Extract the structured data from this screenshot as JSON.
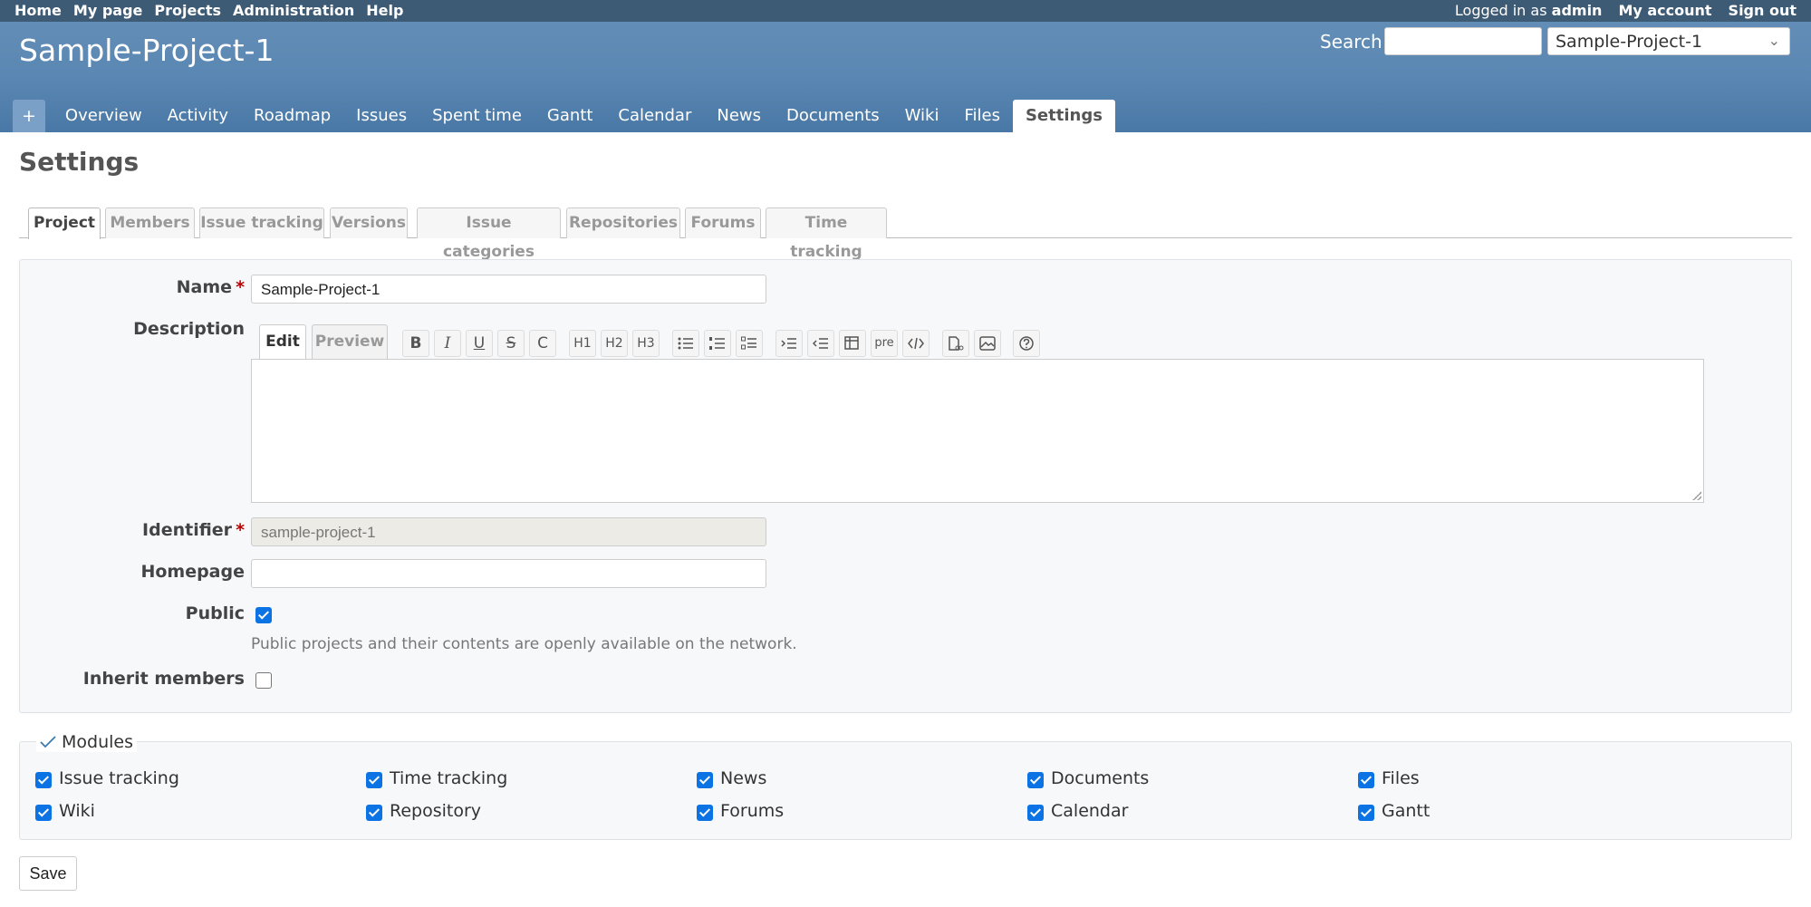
{
  "top_menu": {
    "items": [
      "Home",
      "My page",
      "Projects",
      "Administration",
      "Help"
    ],
    "logged_in_prefix": "Logged in as",
    "user": "admin",
    "my_account": "My account",
    "sign_out": "Sign out"
  },
  "header": {
    "title": "Sample-Project-1",
    "search_label": "Search:",
    "search_value": "",
    "project_select": "Sample-Project-1"
  },
  "main_menu": {
    "new_label": "+",
    "tabs": [
      "Overview",
      "Activity",
      "Roadmap",
      "Issues",
      "Spent time",
      "Gantt",
      "Calendar",
      "News",
      "Documents",
      "Wiki",
      "Files",
      "Settings"
    ],
    "selected": "Settings"
  },
  "page_title": "Settings",
  "subtabs": [
    "Project",
    "Members",
    "Issue tracking",
    "Versions",
    "Issue categories",
    "Repositories",
    "Forums",
    "Time tracking"
  ],
  "form": {
    "name_label": "Name",
    "name_value": "Sample-Project-1",
    "required_mark": "*",
    "description_label": "Description",
    "edit_tab": "Edit",
    "preview_tab": "Preview",
    "toolbar": {
      "bold": "B",
      "italic": "I",
      "underline": "U",
      "strike": "S",
      "code_inline": "C",
      "h1": "H1",
      "h2": "H2",
      "h3": "H3",
      "pre": "pre"
    },
    "description_value": "",
    "identifier_label": "Identifier",
    "identifier_value": "sample-project-1",
    "homepage_label": "Homepage",
    "homepage_value": "",
    "public_label": "Public",
    "public_checked": true,
    "public_hint": "Public projects and their contents are openly available on the network.",
    "inherit_label": "Inherit members",
    "inherit_checked": false
  },
  "modules": {
    "legend": "Modules",
    "items": [
      {
        "label": "Issue tracking",
        "checked": true
      },
      {
        "label": "Time tracking",
        "checked": true
      },
      {
        "label": "News",
        "checked": true
      },
      {
        "label": "Documents",
        "checked": true
      },
      {
        "label": "Files",
        "checked": true
      },
      {
        "label": "Wiki",
        "checked": true
      },
      {
        "label": "Repository",
        "checked": true
      },
      {
        "label": "Forums",
        "checked": true
      },
      {
        "label": "Calendar",
        "checked": true
      },
      {
        "label": "Gantt",
        "checked": true
      }
    ]
  },
  "save_label": "Save",
  "colors": {
    "top_menu_bg": "#3e5b76",
    "header_bg": "#628db6",
    "checkbox_on": "#0b73e4",
    "required": "#bb0000"
  }
}
